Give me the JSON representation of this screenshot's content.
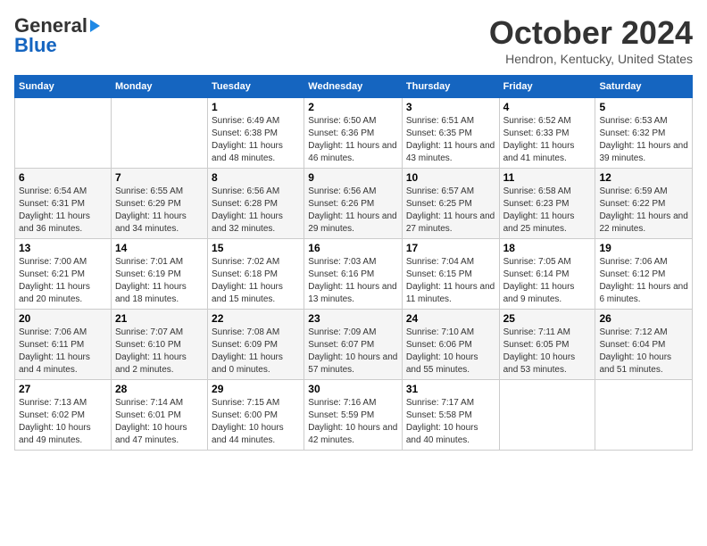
{
  "header": {
    "logo_general": "General",
    "logo_blue": "Blue",
    "month": "October 2024",
    "location": "Hendron, Kentucky, United States"
  },
  "days_of_week": [
    "Sunday",
    "Monday",
    "Tuesday",
    "Wednesday",
    "Thursday",
    "Friday",
    "Saturday"
  ],
  "weeks": [
    [
      {
        "num": "",
        "sunrise": "",
        "sunset": "",
        "daylight": ""
      },
      {
        "num": "",
        "sunrise": "",
        "sunset": "",
        "daylight": ""
      },
      {
        "num": "1",
        "sunrise": "Sunrise: 6:49 AM",
        "sunset": "Sunset: 6:38 PM",
        "daylight": "Daylight: 11 hours and 48 minutes."
      },
      {
        "num": "2",
        "sunrise": "Sunrise: 6:50 AM",
        "sunset": "Sunset: 6:36 PM",
        "daylight": "Daylight: 11 hours and 46 minutes."
      },
      {
        "num": "3",
        "sunrise": "Sunrise: 6:51 AM",
        "sunset": "Sunset: 6:35 PM",
        "daylight": "Daylight: 11 hours and 43 minutes."
      },
      {
        "num": "4",
        "sunrise": "Sunrise: 6:52 AM",
        "sunset": "Sunset: 6:33 PM",
        "daylight": "Daylight: 11 hours and 41 minutes."
      },
      {
        "num": "5",
        "sunrise": "Sunrise: 6:53 AM",
        "sunset": "Sunset: 6:32 PM",
        "daylight": "Daylight: 11 hours and 39 minutes."
      }
    ],
    [
      {
        "num": "6",
        "sunrise": "Sunrise: 6:54 AM",
        "sunset": "Sunset: 6:31 PM",
        "daylight": "Daylight: 11 hours and 36 minutes."
      },
      {
        "num": "7",
        "sunrise": "Sunrise: 6:55 AM",
        "sunset": "Sunset: 6:29 PM",
        "daylight": "Daylight: 11 hours and 34 minutes."
      },
      {
        "num": "8",
        "sunrise": "Sunrise: 6:56 AM",
        "sunset": "Sunset: 6:28 PM",
        "daylight": "Daylight: 11 hours and 32 minutes."
      },
      {
        "num": "9",
        "sunrise": "Sunrise: 6:56 AM",
        "sunset": "Sunset: 6:26 PM",
        "daylight": "Daylight: 11 hours and 29 minutes."
      },
      {
        "num": "10",
        "sunrise": "Sunrise: 6:57 AM",
        "sunset": "Sunset: 6:25 PM",
        "daylight": "Daylight: 11 hours and 27 minutes."
      },
      {
        "num": "11",
        "sunrise": "Sunrise: 6:58 AM",
        "sunset": "Sunset: 6:23 PM",
        "daylight": "Daylight: 11 hours and 25 minutes."
      },
      {
        "num": "12",
        "sunrise": "Sunrise: 6:59 AM",
        "sunset": "Sunset: 6:22 PM",
        "daylight": "Daylight: 11 hours and 22 minutes."
      }
    ],
    [
      {
        "num": "13",
        "sunrise": "Sunrise: 7:00 AM",
        "sunset": "Sunset: 6:21 PM",
        "daylight": "Daylight: 11 hours and 20 minutes."
      },
      {
        "num": "14",
        "sunrise": "Sunrise: 7:01 AM",
        "sunset": "Sunset: 6:19 PM",
        "daylight": "Daylight: 11 hours and 18 minutes."
      },
      {
        "num": "15",
        "sunrise": "Sunrise: 7:02 AM",
        "sunset": "Sunset: 6:18 PM",
        "daylight": "Daylight: 11 hours and 15 minutes."
      },
      {
        "num": "16",
        "sunrise": "Sunrise: 7:03 AM",
        "sunset": "Sunset: 6:16 PM",
        "daylight": "Daylight: 11 hours and 13 minutes."
      },
      {
        "num": "17",
        "sunrise": "Sunrise: 7:04 AM",
        "sunset": "Sunset: 6:15 PM",
        "daylight": "Daylight: 11 hours and 11 minutes."
      },
      {
        "num": "18",
        "sunrise": "Sunrise: 7:05 AM",
        "sunset": "Sunset: 6:14 PM",
        "daylight": "Daylight: 11 hours and 9 minutes."
      },
      {
        "num": "19",
        "sunrise": "Sunrise: 7:06 AM",
        "sunset": "Sunset: 6:12 PM",
        "daylight": "Daylight: 11 hours and 6 minutes."
      }
    ],
    [
      {
        "num": "20",
        "sunrise": "Sunrise: 7:06 AM",
        "sunset": "Sunset: 6:11 PM",
        "daylight": "Daylight: 11 hours and 4 minutes."
      },
      {
        "num": "21",
        "sunrise": "Sunrise: 7:07 AM",
        "sunset": "Sunset: 6:10 PM",
        "daylight": "Daylight: 11 hours and 2 minutes."
      },
      {
        "num": "22",
        "sunrise": "Sunrise: 7:08 AM",
        "sunset": "Sunset: 6:09 PM",
        "daylight": "Daylight: 11 hours and 0 minutes."
      },
      {
        "num": "23",
        "sunrise": "Sunrise: 7:09 AM",
        "sunset": "Sunset: 6:07 PM",
        "daylight": "Daylight: 10 hours and 57 minutes."
      },
      {
        "num": "24",
        "sunrise": "Sunrise: 7:10 AM",
        "sunset": "Sunset: 6:06 PM",
        "daylight": "Daylight: 10 hours and 55 minutes."
      },
      {
        "num": "25",
        "sunrise": "Sunrise: 7:11 AM",
        "sunset": "Sunset: 6:05 PM",
        "daylight": "Daylight: 10 hours and 53 minutes."
      },
      {
        "num": "26",
        "sunrise": "Sunrise: 7:12 AM",
        "sunset": "Sunset: 6:04 PM",
        "daylight": "Daylight: 10 hours and 51 minutes."
      }
    ],
    [
      {
        "num": "27",
        "sunrise": "Sunrise: 7:13 AM",
        "sunset": "Sunset: 6:02 PM",
        "daylight": "Daylight: 10 hours and 49 minutes."
      },
      {
        "num": "28",
        "sunrise": "Sunrise: 7:14 AM",
        "sunset": "Sunset: 6:01 PM",
        "daylight": "Daylight: 10 hours and 47 minutes."
      },
      {
        "num": "29",
        "sunrise": "Sunrise: 7:15 AM",
        "sunset": "Sunset: 6:00 PM",
        "daylight": "Daylight: 10 hours and 44 minutes."
      },
      {
        "num": "30",
        "sunrise": "Sunrise: 7:16 AM",
        "sunset": "Sunset: 5:59 PM",
        "daylight": "Daylight: 10 hours and 42 minutes."
      },
      {
        "num": "31",
        "sunrise": "Sunrise: 7:17 AM",
        "sunset": "Sunset: 5:58 PM",
        "daylight": "Daylight: 10 hours and 40 minutes."
      },
      {
        "num": "",
        "sunrise": "",
        "sunset": "",
        "daylight": ""
      },
      {
        "num": "",
        "sunrise": "",
        "sunset": "",
        "daylight": ""
      }
    ]
  ]
}
